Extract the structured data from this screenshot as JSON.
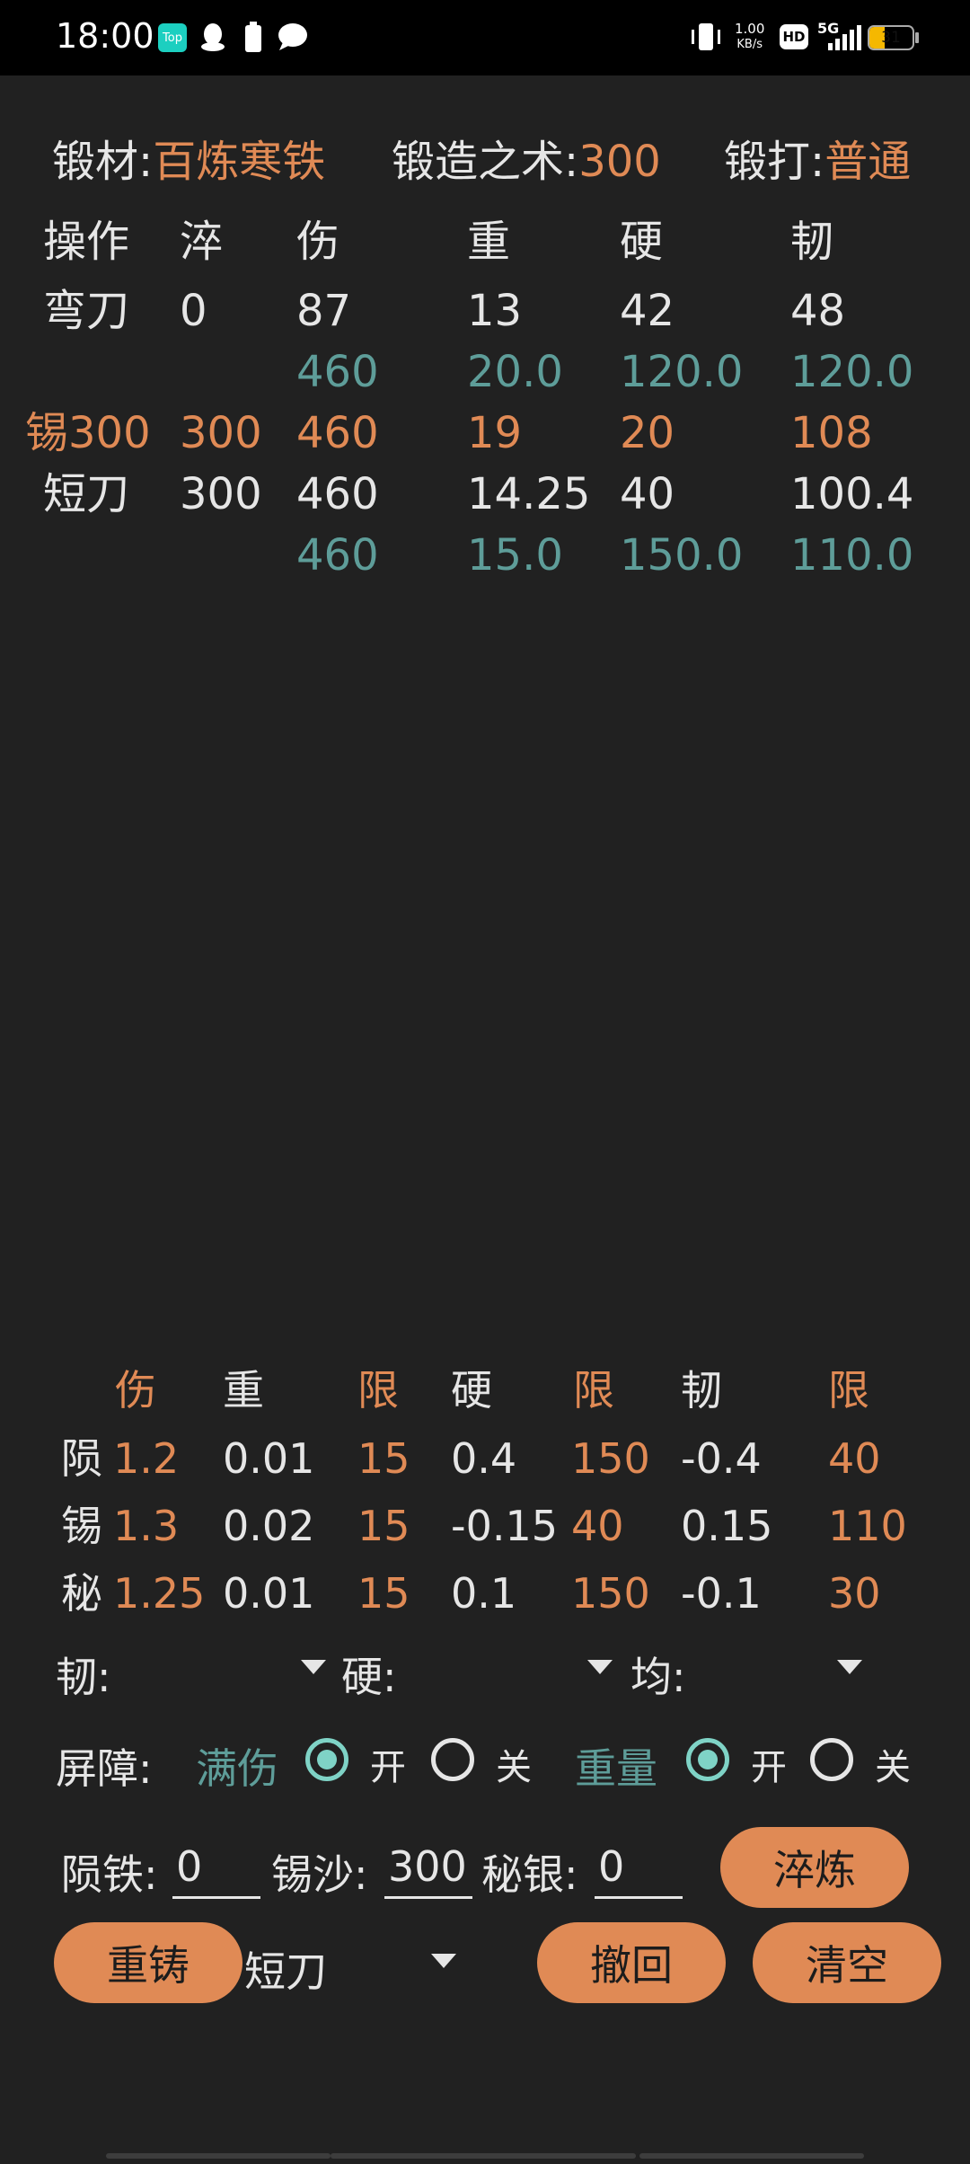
{
  "status_bar": {
    "time": "18:00",
    "app_badge": "Top",
    "net_speed_value": "1.00",
    "net_speed_unit": "KB/s",
    "hd": "HD",
    "network": "5G",
    "battery": "31"
  },
  "header": {
    "material_label": "锻材:",
    "material_value": "百炼寒铁",
    "skill_label": "锻造之术:",
    "skill_value": "300",
    "forge_label": "锻打:",
    "forge_value": "普通"
  },
  "table": {
    "columns": [
      "操作",
      "淬",
      "伤",
      "重",
      "硬",
      "韧"
    ],
    "rows": [
      {
        "style": "normal",
        "cells": [
          "弯刀",
          "0",
          "87",
          "13",
          "42",
          "48"
        ]
      },
      {
        "style": "teal",
        "cells": [
          "",
          "",
          "460",
          "20.0",
          "120.0",
          "120.0"
        ]
      },
      {
        "style": "orange",
        "cells": [
          "锡300",
          "300",
          "460",
          "19",
          "20",
          "108"
        ]
      },
      {
        "style": "normal",
        "cells": [
          "短刀",
          "300",
          "460",
          "14.25",
          "40",
          "100.4"
        ]
      },
      {
        "style": "teal",
        "cells": [
          "",
          "",
          "460",
          "15.0",
          "150.0",
          "110.0"
        ]
      }
    ]
  },
  "coef_table": {
    "headers": [
      "伤",
      "重",
      "限",
      "硬",
      "限",
      "韧",
      "限"
    ],
    "rows": [
      [
        "陨",
        "1.2",
        "0.01",
        "15",
        "0.4",
        "150",
        "-0.4",
        "40"
      ],
      [
        "锡",
        "1.3",
        "0.02",
        "15",
        "-0.15",
        "40",
        "0.15",
        "110"
      ],
      [
        "秘",
        "1.25",
        "0.01",
        "15",
        "0.1",
        "150",
        "-0.1",
        "30"
      ]
    ]
  },
  "dropdowns": {
    "toughness_label": "韧:",
    "hardness_label": "硬:",
    "even_label": "均:"
  },
  "barrier": {
    "label": "屏障:",
    "full_damage": "满伤",
    "weight": "重量",
    "on": "开",
    "off": "关"
  },
  "inputs": {
    "meteor_label": "陨铁:",
    "meteor_value": "0",
    "tin_label": "锡沙:",
    "tin_value": "300",
    "silver_label": "秘银:",
    "silver_value": "0"
  },
  "buttons": {
    "quench": "淬炼",
    "recast": "重铸",
    "undo": "撤回",
    "clear": "清空"
  },
  "weapon_select": {
    "value": "短刀"
  },
  "colors": {
    "background": "#212121",
    "accent": "#e08a55",
    "teal_text": "#5e9d99",
    "radio_on": "#7fd3c6"
  }
}
